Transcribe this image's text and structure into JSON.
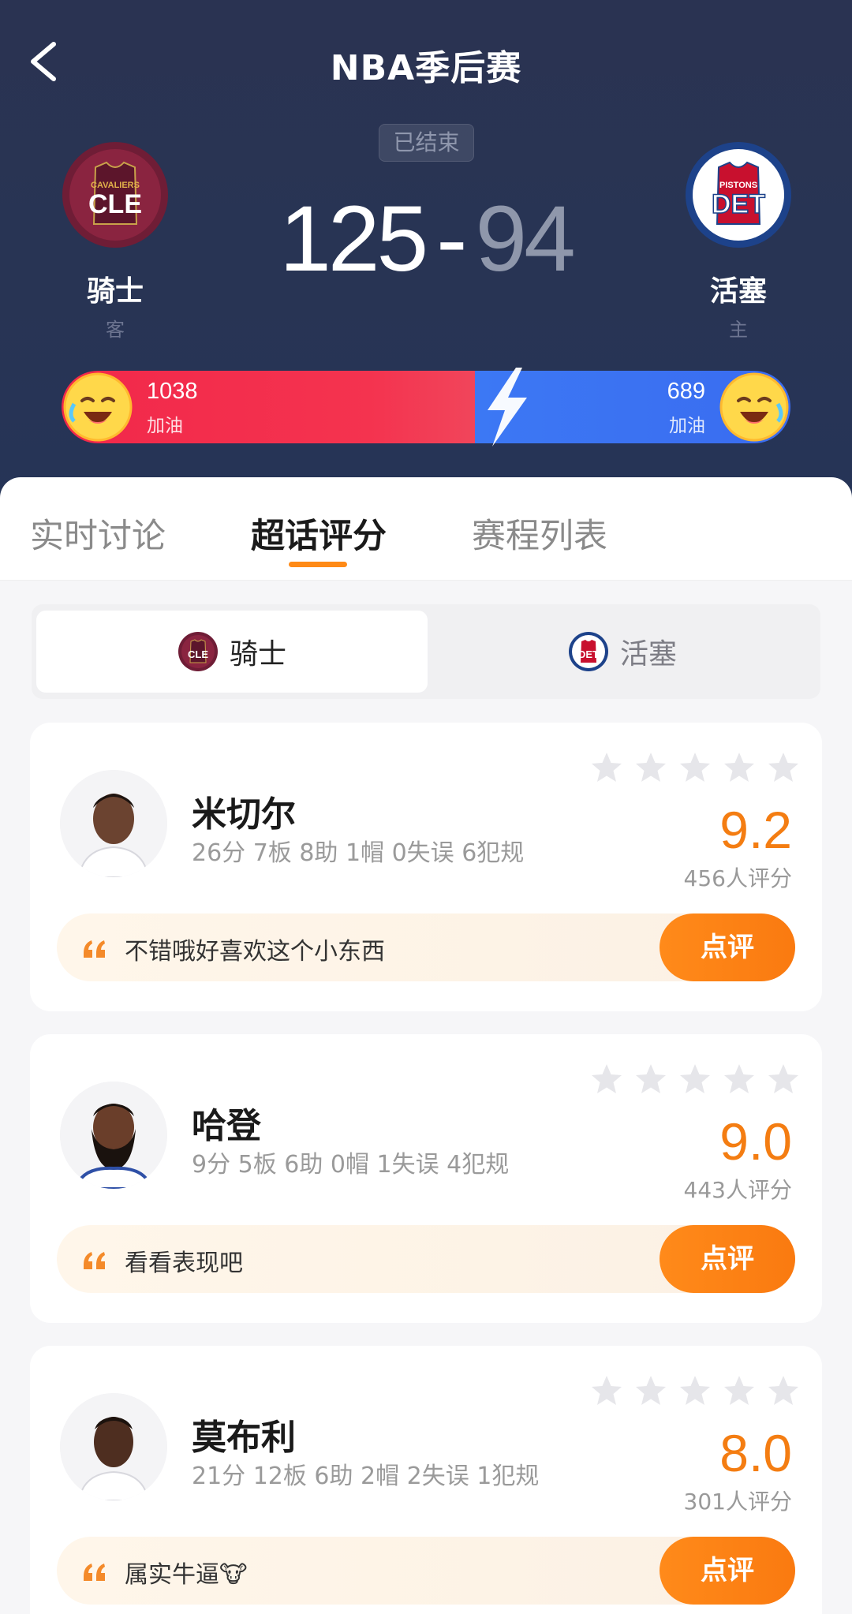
{
  "header": {
    "title": "NBA季后赛",
    "status": "已结束",
    "home_score": "125",
    "dash": "-",
    "away_score": "94",
    "left_team": {
      "name": "骑士",
      "role": "客",
      "logo_text": "CLE",
      "logo_subtext": "CAVALIERS"
    },
    "right_team": {
      "name": "活塞",
      "role": "主",
      "logo_text": "DET",
      "logo_subtext": "PISTONS"
    },
    "cheer": {
      "left_count": "1038",
      "left_label": "加油",
      "right_count": "689",
      "right_label": "加油"
    }
  },
  "tabs": [
    {
      "label": "实时讨论",
      "active": false
    },
    {
      "label": "超话评分",
      "active": true
    },
    {
      "label": "赛程列表",
      "active": false
    }
  ],
  "team_toggle": {
    "left": {
      "label": "骑士",
      "active": true
    },
    "right": {
      "label": "活塞",
      "active": false
    }
  },
  "players": [
    {
      "name": "米切尔",
      "stats": "26分 7板 8助 1帽 0失误 6犯规",
      "rating": "9.2",
      "rating_count": "456人评分",
      "comment": "不错哦好喜欢这个小东西",
      "button": "点评"
    },
    {
      "name": "哈登",
      "stats": "9分 5板 6助 0帽 1失误 4犯规",
      "rating": "9.0",
      "rating_count": "443人评分",
      "comment": "看看表现吧",
      "button": "点评"
    },
    {
      "name": "莫布利",
      "stats": "21分 12板 6助 2帽 2失误 1犯规",
      "rating": "8.0",
      "rating_count": "301人评分",
      "comment": "属实牛逼🐮",
      "button": "点评"
    }
  ],
  "colors": {
    "accent": "#f47d12",
    "cheer_red": "#f2284a",
    "cheer_blue": "#3a6cf0",
    "header_bg": "#283454"
  }
}
